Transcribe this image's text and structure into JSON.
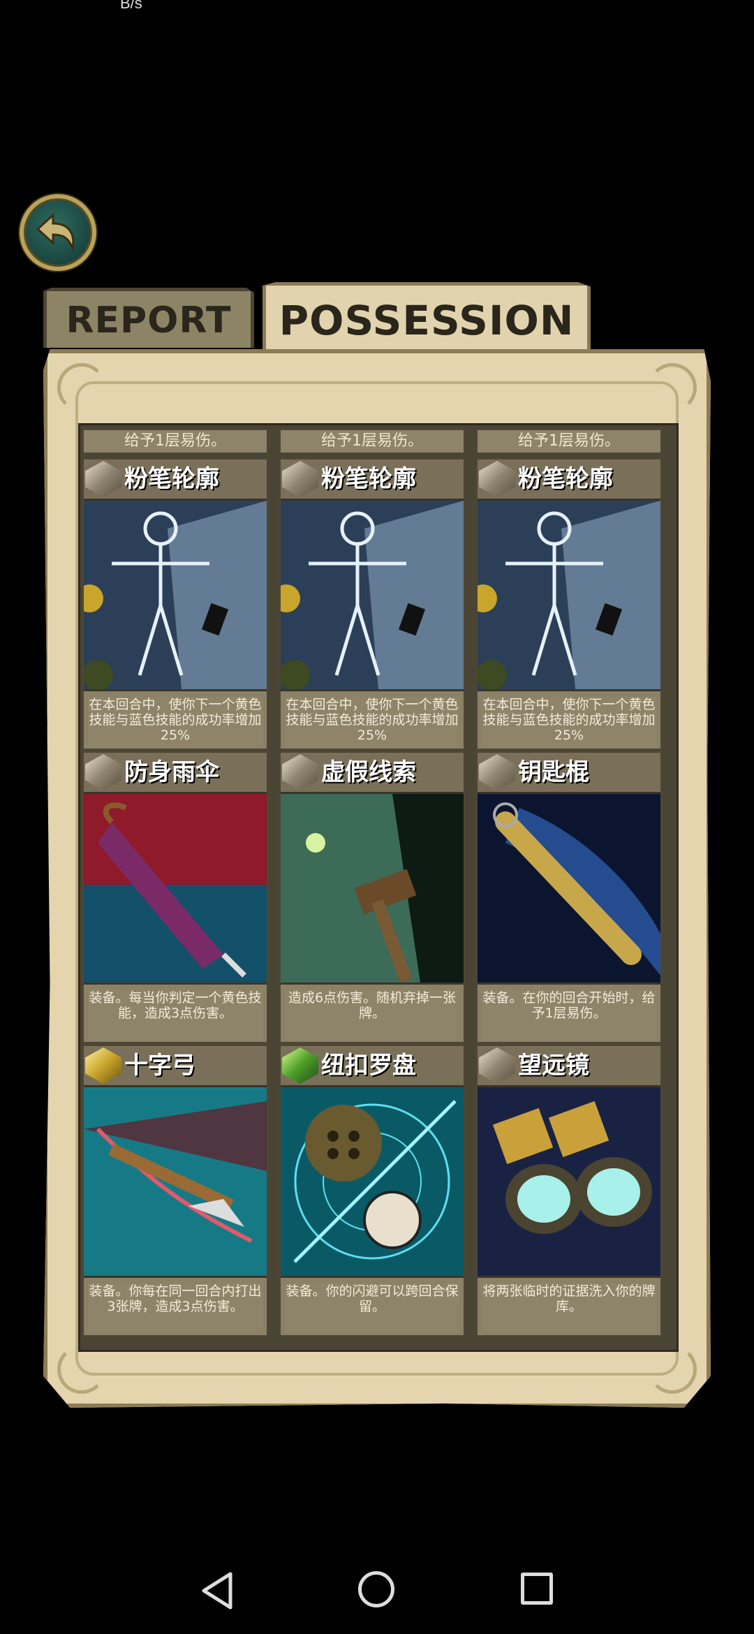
{
  "status": {
    "speed": "B/s"
  },
  "tabs": [
    {
      "label": "REPORT"
    },
    {
      "label": "POSSESSION"
    }
  ],
  "top_row": [
    {
      "desc": "给予1层易伤。"
    },
    {
      "desc": "给予1层易伤。"
    },
    {
      "desc": "给予1层易伤。"
    }
  ],
  "cards": [
    {
      "title": "粉笔轮廓",
      "icon": "chalk-outline-art",
      "gem": "silver",
      "desc": "在本回合中，使你下一个黄色技能与蓝色技能的成功率增加25%"
    },
    {
      "title": "粉笔轮廓",
      "icon": "chalk-outline-art",
      "gem": "silver",
      "desc": "在本回合中，使你下一个黄色技能与蓝色技能的成功率增加25%"
    },
    {
      "title": "粉笔轮廓",
      "icon": "chalk-outline-art",
      "gem": "silver",
      "desc": "在本回合中，使你下一个黄色技能与蓝色技能的成功率增加25%"
    },
    {
      "title": "防身雨伞",
      "icon": "umbrella-art",
      "gem": "silver",
      "desc": "装备。每当你判定一个黄色技能，造成3点伤害。"
    },
    {
      "title": "虚假线索",
      "icon": "false-clue-art",
      "gem": "silver",
      "desc": "造成6点伤害。随机弃掉一张牌。"
    },
    {
      "title": "钥匙棍",
      "icon": "key-stick-art",
      "gem": "silver",
      "desc": "装备。在你的回合开始时，给予1层易伤。"
    },
    {
      "title": "十字弓",
      "icon": "crossbow-art",
      "gem": "gold",
      "desc": "装备。你每在同一回合内打出3张牌，造成3点伤害。"
    },
    {
      "title": "纽扣罗盘",
      "icon": "button-compass-art",
      "gem": "green",
      "desc": "装备。你的闪避可以跨回合保留。"
    },
    {
      "title": "望远镜",
      "icon": "binoculars-art",
      "gem": "silver",
      "desc": "将两张临时的证据洗入你的牌库。"
    }
  ]
}
